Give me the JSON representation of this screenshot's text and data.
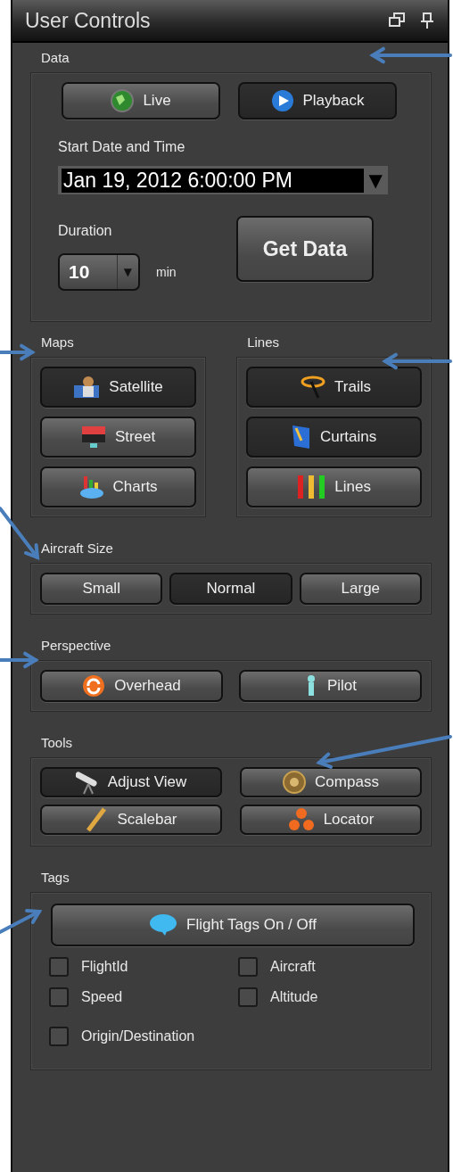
{
  "window": {
    "title": "User Controls"
  },
  "data": {
    "label": "Data",
    "modes": [
      {
        "label": "Live",
        "selected": false
      },
      {
        "label": "Playback",
        "selected": true
      }
    ],
    "start_label": "Start Date and Time",
    "start_value": "Jan 19, 2012 6:00:00 PM",
    "dropdown_glyph": "▼",
    "duration_label": "Duration",
    "duration_value": "10",
    "spinner_glyph": "▼",
    "duration_unit": "min",
    "get_data": "Get Data"
  },
  "maps": {
    "label": "Maps",
    "buttons": [
      {
        "label": "Satellite",
        "selected": true
      },
      {
        "label": "Street",
        "selected": false
      },
      {
        "label": "Charts",
        "selected": false
      }
    ]
  },
  "lines": {
    "label": "Lines",
    "buttons": [
      {
        "label": "Trails",
        "selected": true
      },
      {
        "label": "Curtains",
        "selected": true
      },
      {
        "label": "Lines",
        "selected": false
      }
    ]
  },
  "aircraft_size": {
    "label": "Aircraft Size",
    "buttons": [
      {
        "label": "Small",
        "selected": false
      },
      {
        "label": "Normal",
        "selected": true
      },
      {
        "label": "Large",
        "selected": false
      }
    ]
  },
  "perspective": {
    "label": "Perspective",
    "buttons": [
      {
        "label": "Overhead",
        "selected": false
      },
      {
        "label": "Pilot",
        "selected": false
      }
    ]
  },
  "tools": {
    "label": "Tools",
    "buttons": [
      {
        "label": "Adjust View",
        "selected": true
      },
      {
        "label": "Compass",
        "selected": false
      },
      {
        "label": "Scalebar",
        "selected": false
      },
      {
        "label": "Locator",
        "selected": false
      }
    ]
  },
  "tags": {
    "label": "Tags",
    "toggle": "Flight Tags On / Off",
    "options": [
      {
        "label": "FlightId",
        "checked": false
      },
      {
        "label": "Aircraft",
        "checked": false
      },
      {
        "label": "Speed",
        "checked": false
      },
      {
        "label": "Altitude",
        "checked": false
      },
      {
        "label": "Origin/Destination",
        "checked": false
      }
    ]
  }
}
